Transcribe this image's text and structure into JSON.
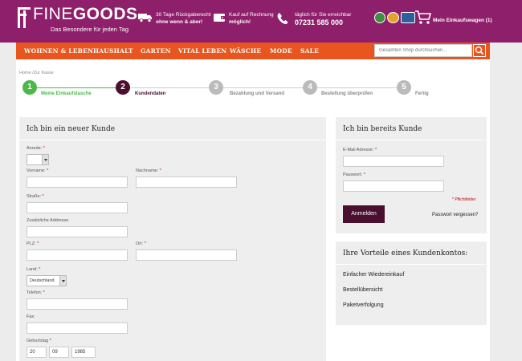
{
  "header": {
    "logo_thin": "FINE",
    "logo_bold": "GOODS",
    "tagline": "Das Besondere für jeden Tag",
    "usp1_line1": "30 Tage Rückgaberecht",
    "usp1_line2": "ohne wenn & aber!",
    "usp2_line1": "Kauf auf Rechnung",
    "usp2_line2": "möglich!",
    "usp3_line1": "täglich für Sie erreichbar",
    "usp3_phone": "07231 585 000",
    "cart_label": "Mein Einkaufswagen (1)",
    "badge_colors": [
      "#3f8f3f",
      "#d84a1b",
      "#2d5f9e"
    ]
  },
  "nav": {
    "items": [
      "WOHNEN & LEBEN",
      "HAUSHALT",
      "GARTEN",
      "VITAL LEBEN",
      "WÄSCHE",
      "MODE",
      "SALE"
    ],
    "search_placeholder": "Gesamten Shop durchsuchen..."
  },
  "breadcrumb": "Home /Zur Kasse",
  "steps": [
    {
      "num": "1",
      "label": "Meine Einkaufstasche",
      "state": "done"
    },
    {
      "num": "2",
      "label": "Kundendaten",
      "state": "active"
    },
    {
      "num": "3",
      "label": "Bezahlung und Versand",
      "state": "todo"
    },
    {
      "num": "4",
      "label": "Bestellung überprüfen",
      "state": "todo"
    },
    {
      "num": "5",
      "label": "Fertig",
      "state": "todo"
    }
  ],
  "new_customer": {
    "title": "Ich bin ein neuer Kunde",
    "anrede_label": "Anrede:",
    "vorname_label": "Vorname:",
    "nachname_label": "Nachname:",
    "strasse_label": "Straße:",
    "zusatz_label": "Zusätzliche Addresse",
    "plz_label": "PLZ:",
    "ort_label": "Ort:",
    "land_label": "Land:",
    "land_value": "Deutschland",
    "telefon_label": "Telefon:",
    "fax_label": "Fax:",
    "geburtstag_label": "Geburtstag",
    "birth_day": "20",
    "birth_month": "09",
    "birth_year": "1985",
    "req": "*"
  },
  "existing_customer": {
    "title": "Ich bin bereits Kunde",
    "email_label": "E-Mail Adresse:",
    "password_label": "Passwort:",
    "pflicht": "* Pflichtfelder",
    "login_button": "Anmelden",
    "forgot": "Passwort vergessen?"
  },
  "benefits": {
    "title": "Ihre Vorteile eines Kundenkontos:",
    "items": [
      "Einfacher Wiedereinkauf",
      "Bestellübersicht",
      "Paketverfolgung"
    ]
  },
  "colors": {
    "header_bg": "#8e1f6a",
    "nav_bg": "#e8551e",
    "step_done": "#4cb848",
    "step_active": "#4a0e2e",
    "step_todo": "#bbbbbb"
  }
}
